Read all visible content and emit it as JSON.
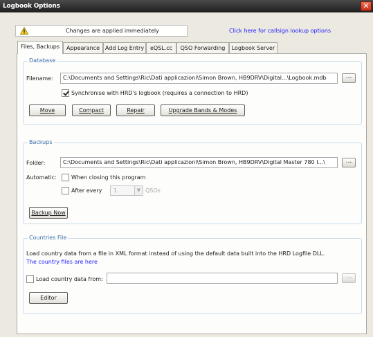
{
  "window": {
    "title": "Logbook Options",
    "close_glyph": "✕"
  },
  "infobar": {
    "icon": "warning-icon",
    "message": "Changes are applied immediately",
    "lookup_link": "Click here for callsign lookup options"
  },
  "tabs": [
    {
      "label": "Files, Backups",
      "active": true
    },
    {
      "label": "Appearance",
      "active": false
    },
    {
      "label": "Add Log Entry",
      "active": false
    },
    {
      "label": "eQSL.cc",
      "active": false
    },
    {
      "label": "QSO Forwarding",
      "active": false
    },
    {
      "label": "Logbook Server",
      "active": false
    }
  ],
  "database": {
    "title": "Database",
    "filename_label": "Filename:",
    "filename_value": "C:\\Documents and Settings\\Ric\\Dati applicazioni\\Simon Brown, HB9DRV\\Digital...\\Logbook.mdb",
    "browse_label": "...",
    "sync_label": "Synchronise with HRD's logbook (requires a connection to HRD)",
    "sync_checked": true,
    "buttons": {
      "move": "Move",
      "compact": "Compact",
      "repair": "Repair",
      "upgrade": "Upgrade Bands & Modes"
    }
  },
  "backups": {
    "title": "Backups",
    "folder_label": "Folder:",
    "folder_value": "C:\\Documents and Settings\\Ric\\Dati applicazioni\\Simon Brown, HB9DRV\\Digital Master 780 I...\\",
    "browse_label": "...",
    "automatic_label": "Automatic:",
    "when_closing_label": "When closing this program",
    "when_closing_checked": false,
    "after_every_label": "After every",
    "after_every_checked": false,
    "interval_value": "1",
    "interval_unit": "QSOs",
    "backup_now_label": "Backup Now"
  },
  "countries": {
    "title": "Countries File",
    "description": "Load country data from a file in XML format instead of using the default data built into the HRD Logfile DLL.",
    "files_link": "The country files are here",
    "load_label": "Load country data from:",
    "load_checked": false,
    "load_value": "",
    "browse_label": "...",
    "editor_label": "Editor"
  }
}
